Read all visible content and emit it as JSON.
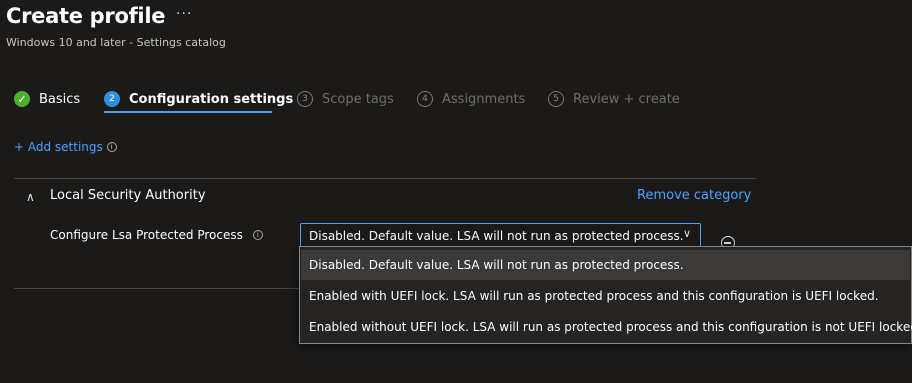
{
  "header": {
    "title": "Create profile",
    "more_label": "···",
    "subtitle": "Windows 10 and later - Settings catalog"
  },
  "steps": [
    {
      "label": "Basics",
      "state": "done",
      "icon": "checkmark-icon",
      "glyph": "✓"
    },
    {
      "label": "Configuration settings",
      "state": "active",
      "number": "2"
    },
    {
      "label": "Scope tags",
      "state": "todo",
      "number": "3"
    },
    {
      "label": "Assignments",
      "state": "todo",
      "number": "4"
    },
    {
      "label": "Review + create",
      "state": "todo",
      "number": "5"
    }
  ],
  "add_settings": {
    "label": "+ Add settings",
    "info": "i"
  },
  "category": {
    "title": "Local Security Authority",
    "remove_label": "Remove category",
    "collapse_glyph": "∧"
  },
  "setting": {
    "label": "Configure Lsa Protected Process",
    "info": "i",
    "selected_value": "Disabled. Default value. LSA will not run as protected process.",
    "chevron": "∨",
    "options": [
      "Disabled. Default value. LSA will not run as protected process.",
      "Enabled with UEFI lock. LSA will run as protected process and this configuration is UEFI locked.",
      "Enabled without UEFI lock. LSA will run as protected process and this configuration is not UEFI locked."
    ]
  },
  "colors": {
    "background": "#1b1a19",
    "accent": "#4aa3ff",
    "success": "#4caf2f",
    "step_active": "#2f8ee0"
  }
}
